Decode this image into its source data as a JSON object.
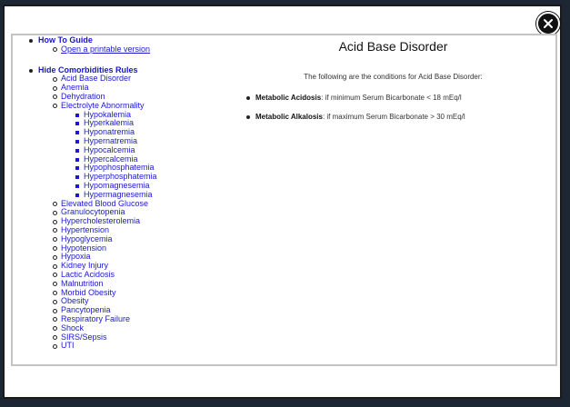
{
  "sidebar": {
    "how_to": {
      "title": "How To Guide",
      "link": "Open a printable version"
    },
    "rules": {
      "title": "Hide Comorbidities Rules",
      "items_before": [
        "Acid Base Disorder",
        "Anemia",
        "Dehydration",
        "Electrolyte Abnormality"
      ],
      "electrolyte_subitems": [
        "Hypokalemia",
        "Hyperkalemia",
        "Hyponatremia",
        "Hypernatremia",
        "Hypocalcemia",
        "Hypercalcemia",
        "Hypophosphatemia",
        "Hyperphosphatemia",
        "Hypomagnesemia",
        "Hypermagnesemia"
      ],
      "items_after": [
        "Elevated Blood Glucose",
        "Granulocytopenia",
        "Hypercholesterolemia",
        "Hypertension",
        "Hypoglycemia",
        "Hypotension",
        "Hypoxia",
        "Kidney Injury",
        "Lactic Acidosis",
        "Malnutrition",
        "Morbid Obesity",
        "Obesity",
        "Pancytopenia",
        "Respiratory Failure",
        "Shock",
        "SIRS/Sepsis",
        "UTI"
      ]
    }
  },
  "main": {
    "title": "Acid Base Disorder",
    "intro": "The following are the conditions for Acid Base Disorder:",
    "conditions": [
      {
        "name": "Metabolic Acidosis",
        "rule": ": if minimum Serum Bicarbonate < 18 mEq/l"
      },
      {
        "name": "Metabolic Alkalosis",
        "rule": ": if maximum Serum Bicarbonate > 30 mEq/l"
      }
    ]
  },
  "icons": {
    "close": "close-icon"
  },
  "colors": {
    "link": "#1a1acc",
    "frame_border": "#c4c4c4",
    "backdrop": "#1c2733"
  }
}
